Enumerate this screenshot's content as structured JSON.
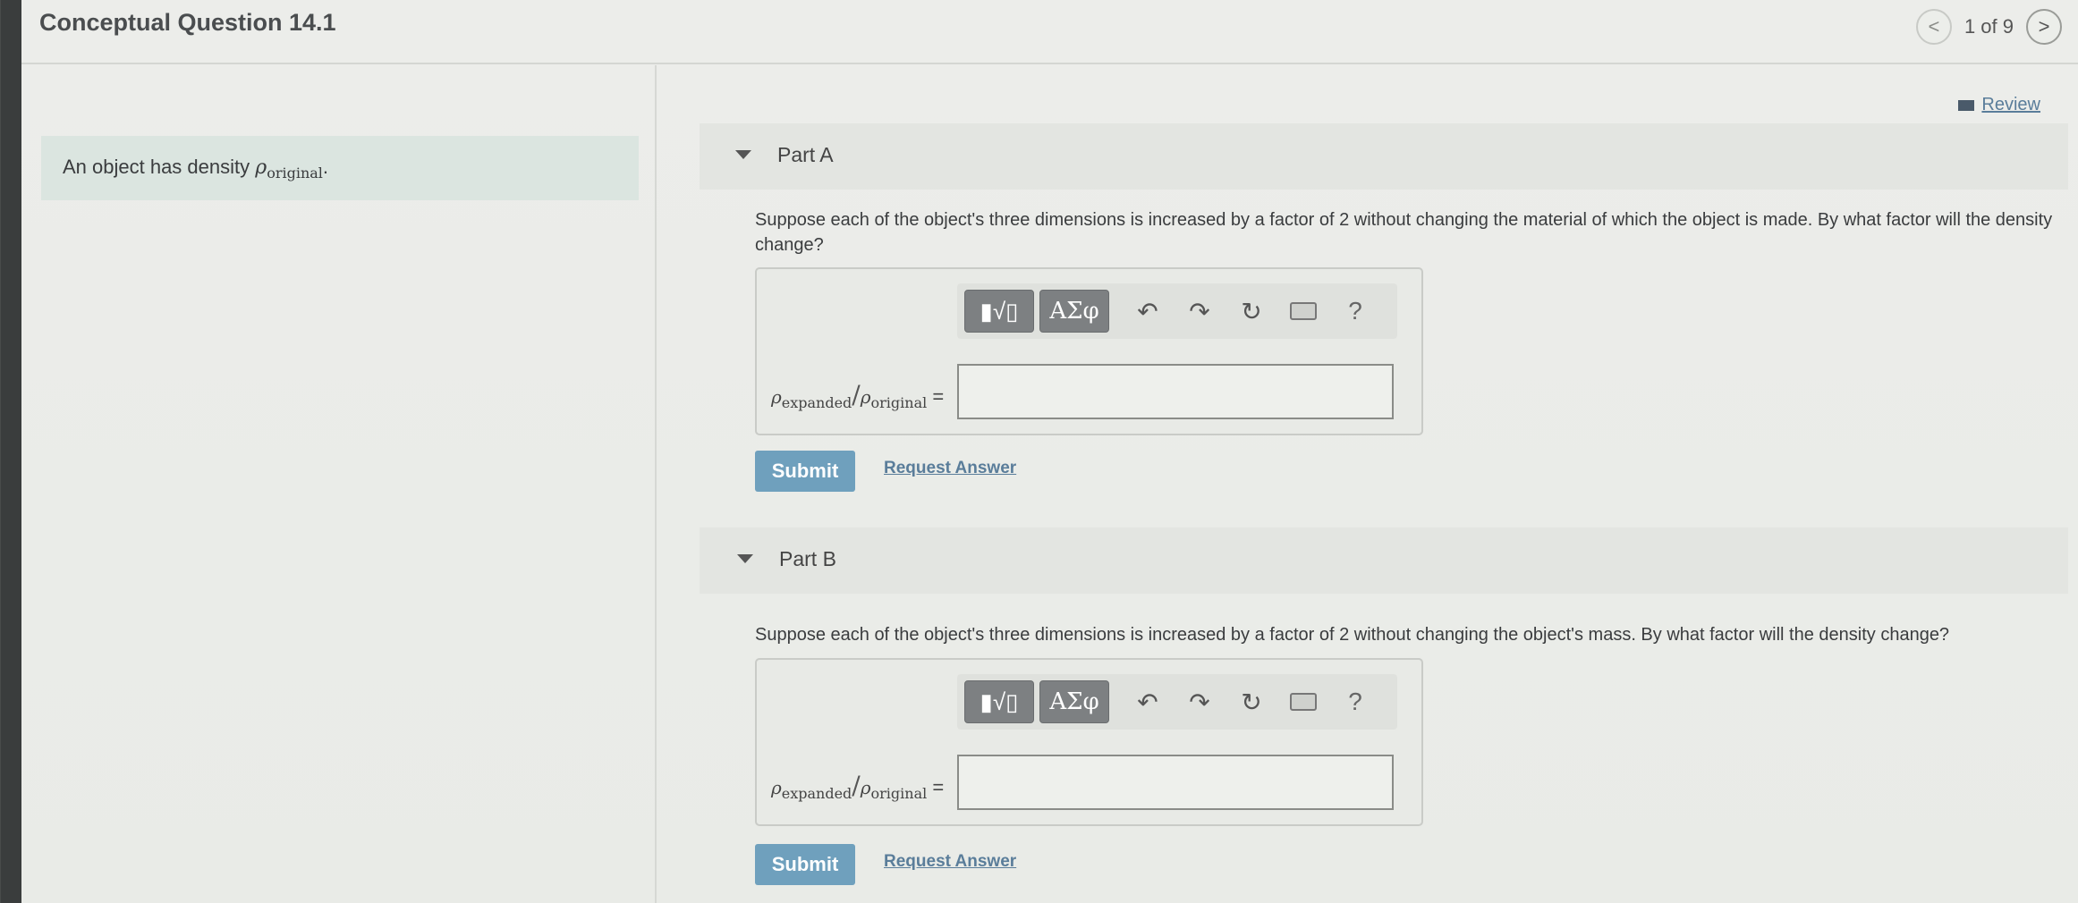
{
  "header": {
    "title": "Conceptual Question 14.1",
    "pager_text": "1 of 9",
    "prev_glyph": "<",
    "next_glyph": ">"
  },
  "review_label": "Review",
  "intro": {
    "text": "An object has density ",
    "symbol": "ρ",
    "subscript": "original",
    "suffix": "."
  },
  "toolbar": {
    "template_label": "▮√▯",
    "greek_label": "ΑΣφ",
    "undo_glyph": "↶",
    "redo_glyph": "↷",
    "reset_glyph": "↻",
    "help_label": "?"
  },
  "parts": [
    {
      "label": "Part A",
      "question": "Suppose each of the object's three dimensions is increased by a factor of 2 without changing the material of which the object is made. By what factor will the density change?",
      "eq_num_symbol": "ρ",
      "eq_num_sub": "expanded",
      "eq_den_symbol": "ρ",
      "eq_den_sub": "original",
      "equals": "=",
      "input_value": "",
      "submit_label": "Submit",
      "request_label": "Request Answer"
    },
    {
      "label": "Part B",
      "question": "Suppose each of the object's three dimensions is increased by a factor of 2 without changing the object's mass. By what factor will the density change?",
      "eq_num_symbol": "ρ",
      "eq_num_sub": "expanded",
      "eq_den_symbol": "ρ",
      "eq_den_sub": "original",
      "equals": "=",
      "input_value": "",
      "submit_label": "Submit",
      "request_label": "Request Answer"
    }
  ]
}
